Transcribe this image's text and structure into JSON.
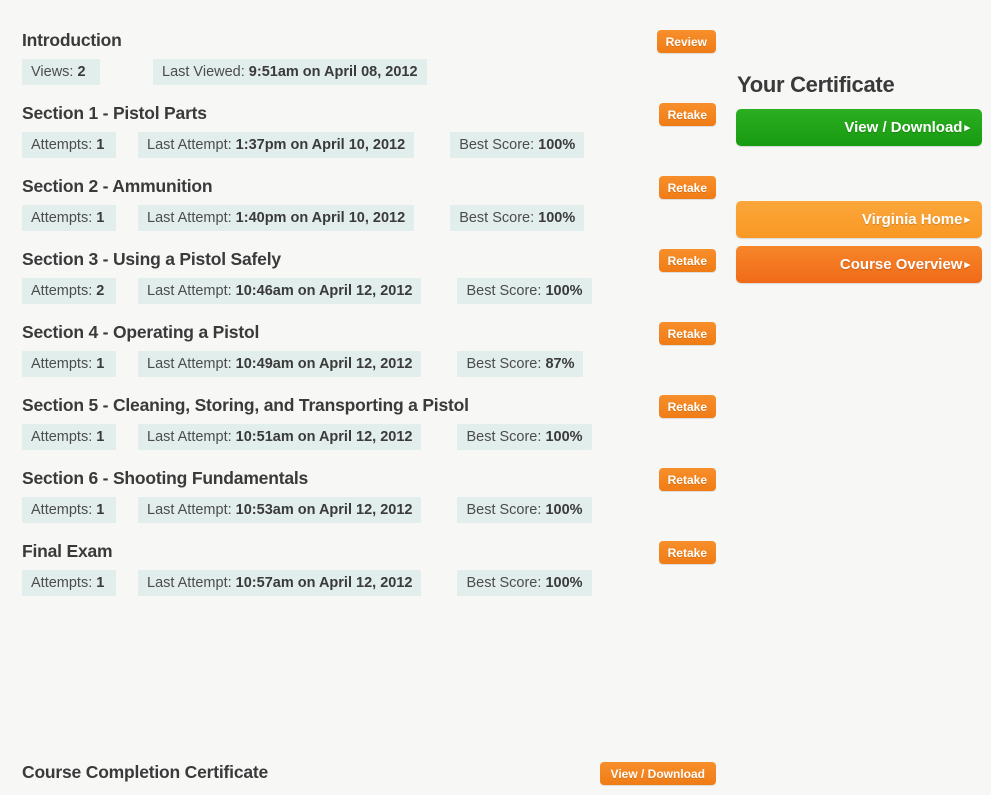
{
  "colors": {
    "page_background": "#f7f7f6",
    "pill_background": "#e2eeec",
    "accent_orange": "#f58220",
    "accent_orange_light": "#f99d28",
    "accent_orange_dark": "#f06a18",
    "accent_green": "#1fa01c",
    "heading_text": "#3a3a3a"
  },
  "main": {
    "rows": [
      {
        "title": "Introduction",
        "stat1_label": "Views:",
        "stat1_value": "2",
        "stat2_label": "Last Viewed:",
        "stat2_value": "9:51am on April 08, 2012",
        "stat3_label": "",
        "stat3_value": "",
        "action_label": "Review",
        "action_name": "review-button"
      },
      {
        "title": "Section 1 - Pistol Parts",
        "stat1_label": "Attempts:",
        "stat1_value": "1",
        "stat2_label": "Last Attempt:",
        "stat2_value": "1:37pm on April 10, 2012",
        "stat3_label": "Best Score:",
        "stat3_value": "100%",
        "action_label": "Retake",
        "action_name": "retake-button"
      },
      {
        "title": "Section 2 - Ammunition",
        "stat1_label": "Attempts:",
        "stat1_value": "1",
        "stat2_label": "Last Attempt:",
        "stat2_value": "1:40pm on April 10, 2012",
        "stat3_label": "Best Score:",
        "stat3_value": "100%",
        "action_label": "Retake",
        "action_name": "retake-button"
      },
      {
        "title": "Section 3 - Using a Pistol Safely",
        "stat1_label": "Attempts:",
        "stat1_value": "2",
        "stat2_label": "Last Attempt:",
        "stat2_value": "10:46am on April 12, 2012",
        "stat3_label": "Best Score:",
        "stat3_value": "100%",
        "action_label": "Retake",
        "action_name": "retake-button"
      },
      {
        "title": "Section 4 - Operating a Pistol",
        "stat1_label": "Attempts:",
        "stat1_value": "1",
        "stat2_label": "Last Attempt:",
        "stat2_value": "10:49am on April 12, 2012",
        "stat3_label": "Best Score:",
        "stat3_value": "87%",
        "action_label": "Retake",
        "action_name": "retake-button"
      },
      {
        "title": "Section 5 - Cleaning, Storing, and Transporting a Pistol",
        "stat1_label": "Attempts:",
        "stat1_value": "1",
        "stat2_label": "Last Attempt:",
        "stat2_value": "10:51am on April 12, 2012",
        "stat3_label": "Best Score:",
        "stat3_value": "100%",
        "action_label": "Retake",
        "action_name": "retake-button"
      },
      {
        "title": "Section 6 - Shooting Fundamentals",
        "stat1_label": "Attempts:",
        "stat1_value": "1",
        "stat2_label": "Last Attempt:",
        "stat2_value": "10:53am on April 12, 2012",
        "stat3_label": "Best Score:",
        "stat3_value": "100%",
        "action_label": "Retake",
        "action_name": "retake-button"
      },
      {
        "title": "Final Exam",
        "stat1_label": "Attempts:",
        "stat1_value": "1",
        "stat2_label": "Last Attempt:",
        "stat2_value": "10:57am on April 12, 2012",
        "stat3_label": "Best Score:",
        "stat3_value": "100%",
        "action_label": "Retake",
        "action_name": "retake-button"
      }
    ],
    "certificate_row": {
      "title": "Course Completion Certificate",
      "action_label": "View / Download"
    }
  },
  "sidebar": {
    "heading": "Your Certificate",
    "buttons": [
      {
        "label": "View / Download",
        "arrow": "▸",
        "color": "#1fa01c"
      },
      {
        "label": "Virginia Home",
        "arrow": "▸",
        "color": "#f99d28"
      },
      {
        "label": "Course Overview",
        "arrow": "▸",
        "color": "#f06a18"
      }
    ]
  }
}
